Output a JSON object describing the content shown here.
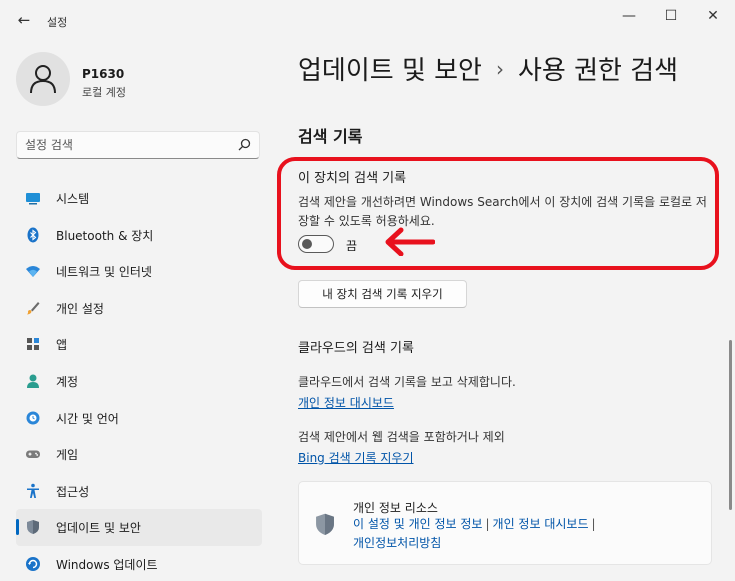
{
  "window": {
    "title": "설정",
    "back_icon": "back-arrow-icon",
    "controls": [
      "minimize-icon",
      "maximize-icon",
      "close-icon"
    ]
  },
  "profile": {
    "name": "P1630",
    "account_type": "로컬 계정"
  },
  "search": {
    "placeholder": "설정 검색"
  },
  "sidebar": {
    "items": [
      {
        "label": "시스템",
        "icon": "system-icon"
      },
      {
        "label": "Bluetooth & 장치",
        "icon": "bluetooth-icon"
      },
      {
        "label": "네트워크 및 인터넷",
        "icon": "network-icon"
      },
      {
        "label": "개인 설정",
        "icon": "brush-icon"
      },
      {
        "label": "앱",
        "icon": "apps-icon"
      },
      {
        "label": "계정",
        "icon": "account-icon"
      },
      {
        "label": "시간 및 언어",
        "icon": "time-language-icon"
      },
      {
        "label": "게임",
        "icon": "gaming-icon"
      },
      {
        "label": "접근성",
        "icon": "accessibility-icon"
      },
      {
        "label": "업데이트 및 보안",
        "icon": "shield-icon",
        "active": true
      },
      {
        "label": "Windows 업데이트",
        "icon": "windows-update-icon"
      }
    ]
  },
  "breadcrumb": {
    "parent": "업데이트 및 보안",
    "separator": "›",
    "current": "사용 권한 검색"
  },
  "main": {
    "section_title": "검색 기록",
    "device_history": {
      "title": "이 장치의 검색 기록",
      "description": "검색 제안을 개선하려면 Windows Search에서 이 장치에 검색 기록을 로컬로 저장할 수 있도록 허용하세요.",
      "toggle_state": "끔",
      "toggle_on": false
    },
    "clear_button": "내 장치 검색 기록 지우기",
    "cloud": {
      "title": "클라우드의 검색 기록",
      "desc1": "클라우드에서 검색 기록을 보고 삭제합니다.",
      "link1": "개인 정보 대시보드",
      "desc2": "검색 제안에서 웹 검색을 포함하거나 제외",
      "link2": "Bing 검색 기록 지우기"
    },
    "privacy_card": {
      "title": "개인 정보 리소스",
      "links": [
        "이 설정 및 개인 정보 정보",
        "개인 정보 대시보드",
        "개인정보처리방침"
      ],
      "separator": "|"
    }
  },
  "colors": {
    "accent": "#0067c0",
    "link": "#0054a8",
    "highlight": "#e8111d"
  }
}
